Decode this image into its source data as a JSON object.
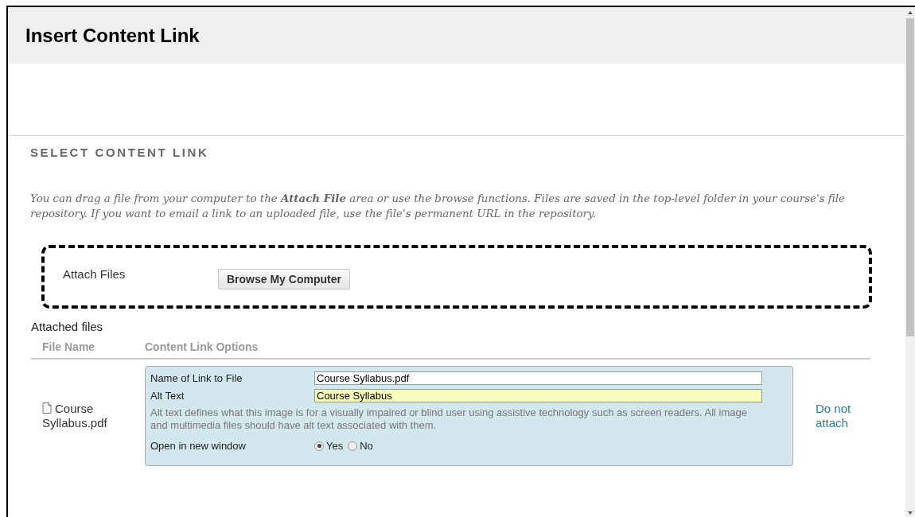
{
  "window": {
    "title": "Insert Content Link"
  },
  "section": {
    "heading": "SELECT CONTENT LINK",
    "instructions": "You can drag a file from your computer to the **Attach File** area or use the browse functions. Files are saved in the top-level folder in your course's file repository. If you want to email a link to an uploaded file, use the file's permanent URL in the repository."
  },
  "attach": {
    "label": "Attach Files",
    "button": "Browse My Computer"
  },
  "attached_files": {
    "title": "Attached files",
    "columns": [
      "File Name",
      "Content Link Options"
    ],
    "rows": [
      {
        "file_name": "Course Syllabus.pdf",
        "link_name_label": "Name of Link to File",
        "link_name_value": "Course Syllabus.pdf",
        "alt_text_label": "Alt Text",
        "alt_text_value": "Course Syllabus",
        "alt_text_help": "Alt text defines what this image is for a visually impaired or blind user using assistive technology such as screen readers. All image and multimedia files should have alt text associated with them.",
        "new_window_label": "Open in new window",
        "new_window_options": [
          {
            "label": "Yes",
            "selected": true
          },
          {
            "label": "No",
            "selected": false
          }
        ],
        "action": "Do not attach"
      }
    ]
  }
}
